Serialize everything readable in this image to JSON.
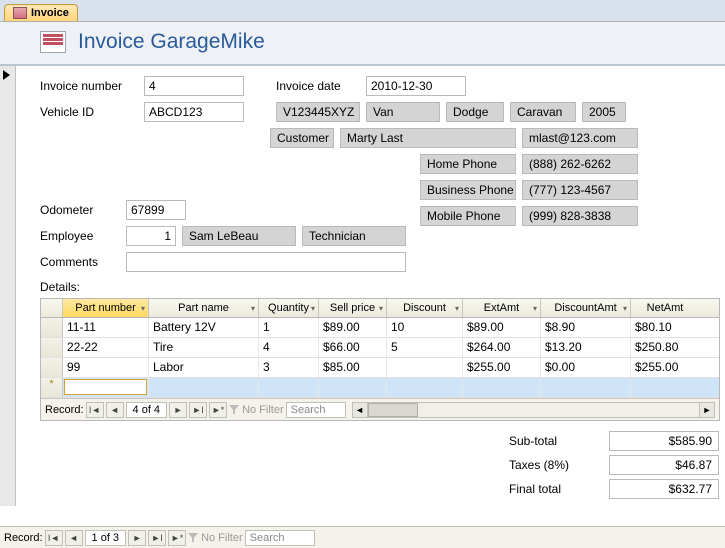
{
  "tab": {
    "label": "Invoice"
  },
  "header": {
    "title": "Invoice GarageMike"
  },
  "labels": {
    "invoice_number": "Invoice number",
    "invoice_date": "Invoice date",
    "vehicle_id": "Vehicle ID",
    "customer": "Customer",
    "home_phone": "Home Phone",
    "business_phone": "Business Phone",
    "mobile_phone": "Mobile Phone",
    "odometer": "Odometer",
    "employee": "Employee",
    "comments": "Comments",
    "details": "Details:"
  },
  "fields": {
    "invoice_number": "4",
    "invoice_date": "2010-12-30",
    "vehicle_id": "ABCD123",
    "vehicle_vin": "V123445XYZ",
    "vehicle_type": "Van",
    "vehicle_make": "Dodge",
    "vehicle_model": "Caravan",
    "vehicle_year": "2005",
    "customer_name": "Marty Last",
    "customer_email": "mlast@123.com",
    "home_phone": "(888) 262-6262",
    "business_phone": "(777) 123-4567",
    "mobile_phone": "(999) 828-3838",
    "odometer": "67899",
    "employee_id": "1",
    "employee_name": "Sam LeBeau",
    "employee_title": "Technician",
    "comments": ""
  },
  "grid": {
    "headers": {
      "part_number": "Part number",
      "part_name": "Part name",
      "quantity": "Quantity",
      "sell_price": "Sell price",
      "discount": "Discount",
      "ext_amt": "ExtAmt",
      "discount_amt": "DiscountAmt",
      "net_amt": "NetAmt"
    },
    "rows": [
      {
        "part_number": "11-11",
        "part_name": "Battery 12V",
        "quantity": "1",
        "sell_price": "$89.00",
        "discount": "10",
        "ext_amt": "$89.00",
        "discount_amt": "$8.90",
        "net_amt": "$80.10"
      },
      {
        "part_number": "22-22",
        "part_name": "Tire",
        "quantity": "4",
        "sell_price": "$66.00",
        "discount": "5",
        "ext_amt": "$264.00",
        "discount_amt": "$13.20",
        "net_amt": "$250.80"
      },
      {
        "part_number": "99",
        "part_name": "Labor",
        "quantity": "3",
        "sell_price": "$85.00",
        "discount": "",
        "ext_amt": "$255.00",
        "discount_amt": "$0.00",
        "net_amt": "$255.00"
      }
    ],
    "nav": {
      "label": "Record:",
      "position": "4 of 4",
      "no_filter": "No Filter",
      "search": "Search"
    }
  },
  "totals": {
    "subtotal_label": "Sub-total",
    "subtotal": "$585.90",
    "taxes_label": "Taxes (8%)",
    "taxes": "$46.87",
    "final_label": "Final total",
    "final": "$632.77"
  },
  "main_nav": {
    "label": "Record:",
    "position": "1 of 3",
    "no_filter": "No Filter",
    "search": "Search"
  }
}
